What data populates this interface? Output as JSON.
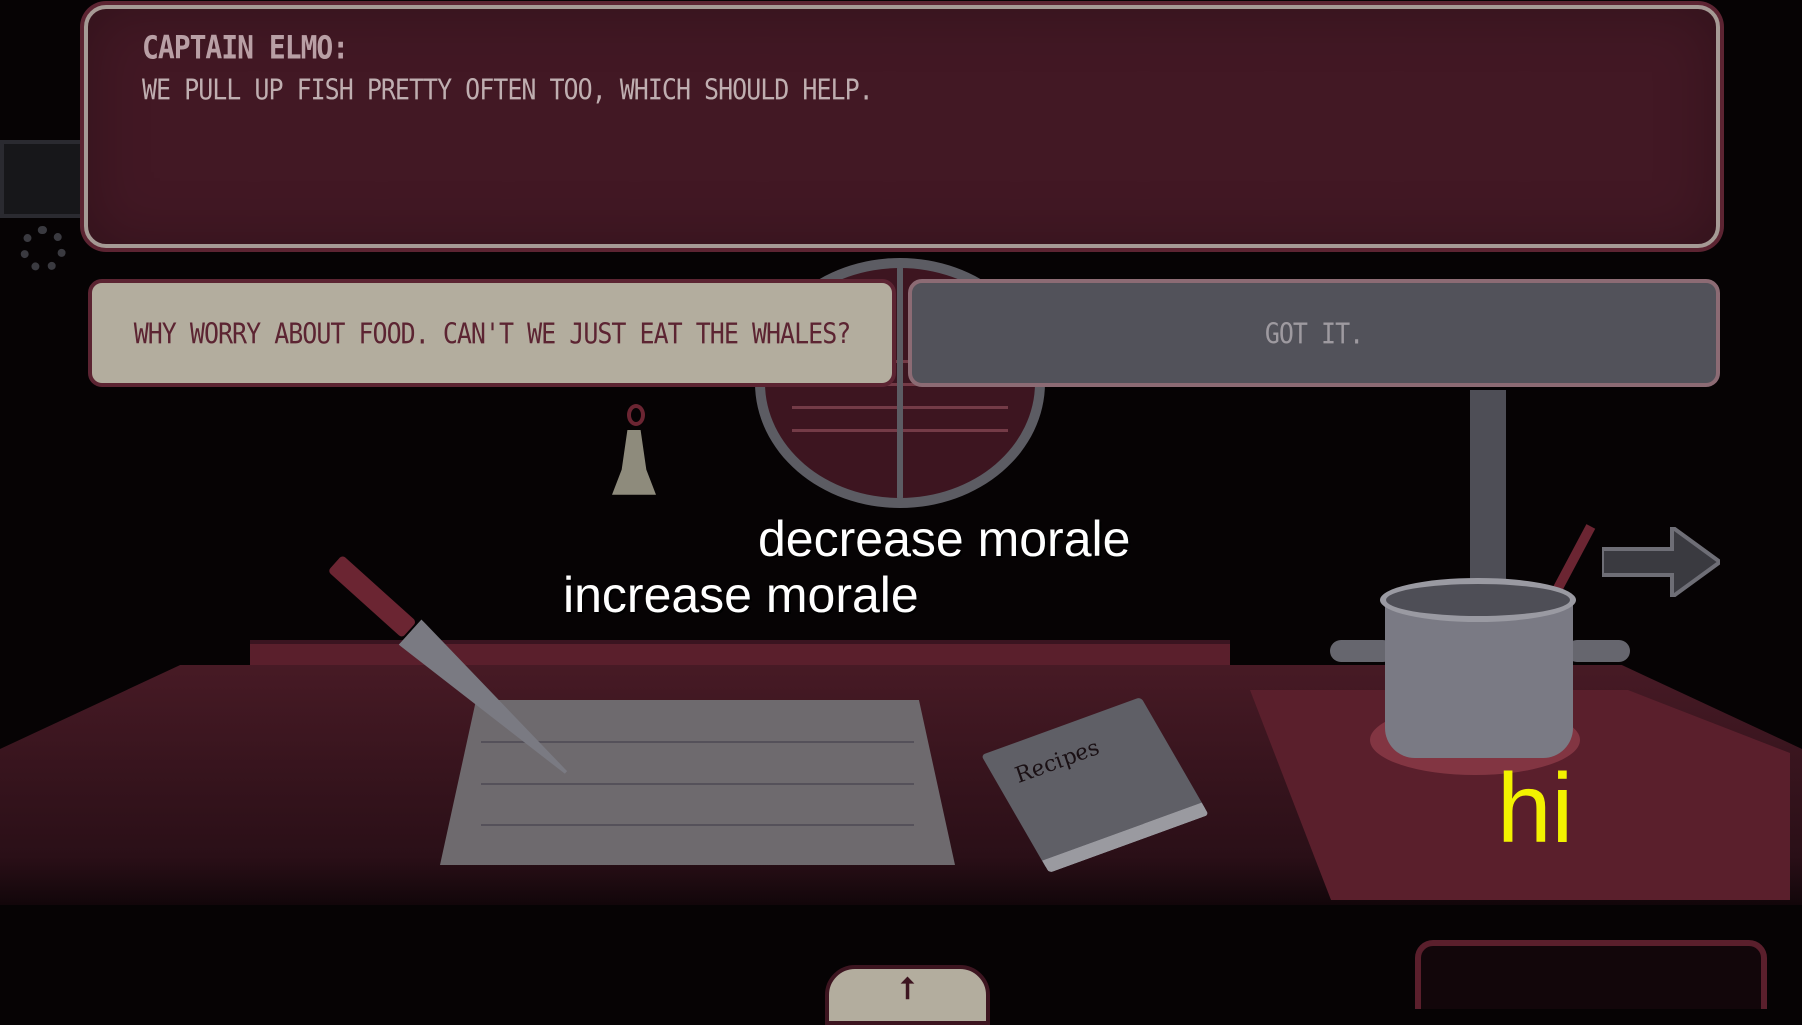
{
  "dialog": {
    "speaker": "CAPTAIN ELMO:",
    "text": "WE PULL UP FISH PRETTY OFTEN TOO, WHICH SHOULD HELP."
  },
  "choices": [
    {
      "label": "WHY WORRY ABOUT FOOD. CAN'T WE JUST EAT THE WHALES?"
    },
    {
      "label": "GOT IT."
    }
  ],
  "overlay": {
    "decrease": "decrease morale",
    "increase": "increase morale",
    "hi": "hi"
  },
  "nav": {
    "right_icon": "arrow-right-icon",
    "up_icon": "arrow-up-icon",
    "up_glyph": "⭡"
  },
  "scene": {
    "book_title": "Recipes"
  },
  "colors": {
    "dialog_bg": "#421824",
    "choice_selected": "#b3ad9e",
    "choice_default": "#52525a",
    "overlay_hi": "#f2f200"
  }
}
